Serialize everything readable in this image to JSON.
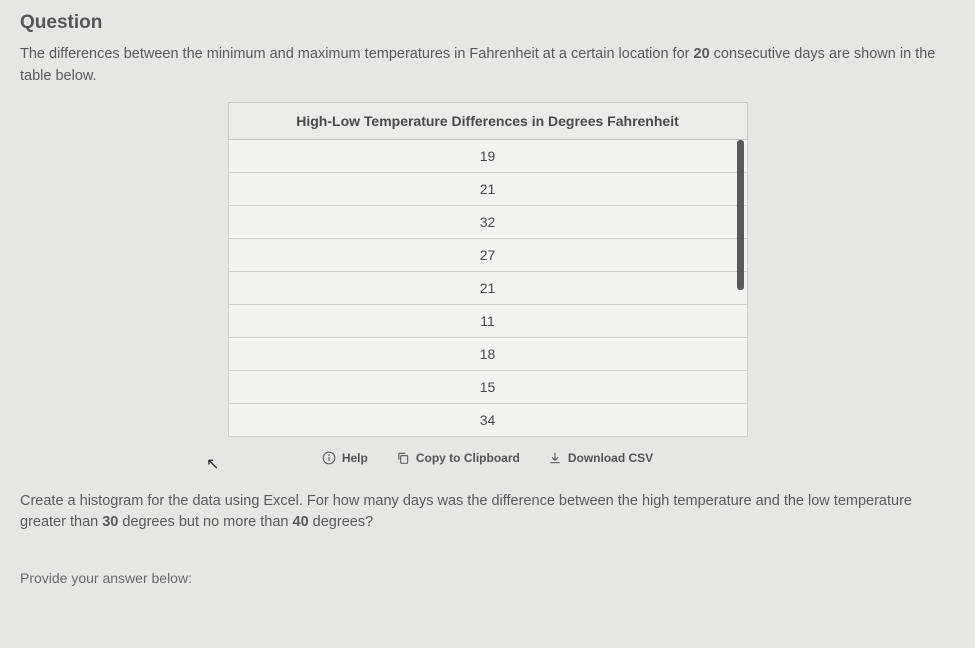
{
  "heading": "Question",
  "intro_part1": "The differences between the minimum and maximum temperatures in Fahrenheit at a certain location for ",
  "intro_days": "20",
  "intro_part2": " consecutive days are shown in the table below.",
  "table": {
    "header": "High-Low Temperature Differences in Degrees Fahrenheit",
    "rows": [
      "19",
      "21",
      "32",
      "27",
      "21",
      "11",
      "18",
      "15",
      "34"
    ]
  },
  "actions": {
    "help": "Help",
    "copy": "Copy to Clipboard",
    "download": "Download CSV"
  },
  "instruction_part1": "Create a histogram for the data using Excel. For how many days was the difference between the high temperature and the low temperature greater than ",
  "instruction_v1": "30",
  "instruction_part2": " degrees but no more than ",
  "instruction_v2": "40",
  "instruction_part3": " degrees?",
  "answer_prompt": "Provide your answer below:"
}
